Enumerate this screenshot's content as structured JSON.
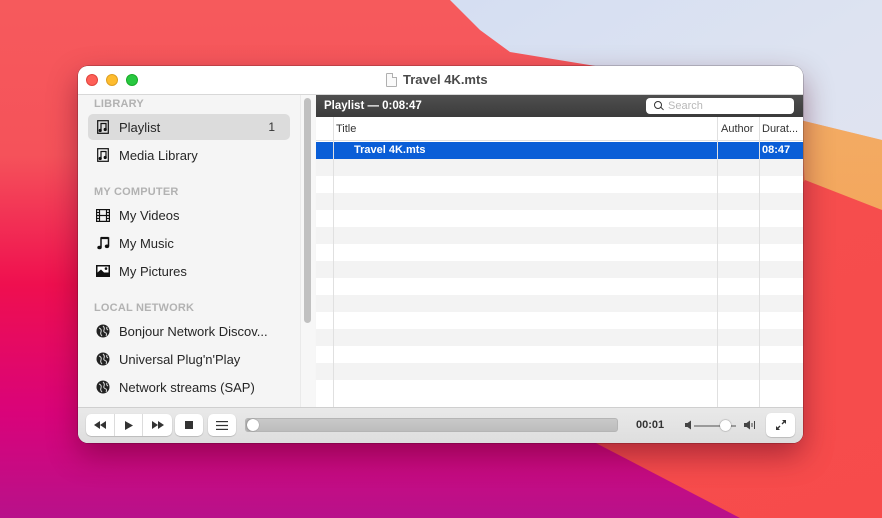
{
  "window": {
    "title": "Travel 4K.mts",
    "traffic_lights": {
      "close_color": "#fe5f57",
      "minimize_color": "#febc2e",
      "maximize_color": "#28c840"
    }
  },
  "sidebar": {
    "sections": [
      {
        "title": "LIBRARY",
        "items": [
          {
            "label": "Playlist",
            "icon": "playlist-icon",
            "badge": "1",
            "selected": true
          },
          {
            "label": "Media Library",
            "icon": "playlist-icon",
            "badge": "",
            "selected": false
          }
        ]
      },
      {
        "title": "MY COMPUTER",
        "items": [
          {
            "label": "My Videos",
            "icon": "film-icon"
          },
          {
            "label": "My Music",
            "icon": "music-note-icon"
          },
          {
            "label": "My Pictures",
            "icon": "picture-icon"
          }
        ]
      },
      {
        "title": "LOCAL NETWORK",
        "items": [
          {
            "label": "Bonjour Network Discov...",
            "icon": "network-globe-icon"
          },
          {
            "label": "Universal Plug'n'Play",
            "icon": "network-globe-icon"
          },
          {
            "label": "Network streams (SAP)",
            "icon": "network-globe-icon"
          }
        ]
      }
    ]
  },
  "playlist": {
    "header_title": "Playlist — 0:08:47",
    "search_placeholder": "Search",
    "search_value": "",
    "columns": [
      "Title",
      "Author",
      "Durat..."
    ],
    "rows": [
      {
        "title": "Travel 4K.mts",
        "author": "",
        "duration": "08:47",
        "selected": true
      }
    ],
    "selection_color": "#0a5ed7"
  },
  "controls": {
    "rewind_icon": "rewind-icon",
    "play_icon": "play-icon",
    "forward_icon": "fast-forward-icon",
    "stop_icon": "stop-icon",
    "playlist_toggle_icon": "list-icon",
    "elapsed_time": "00:01",
    "progress_fraction": 0.002,
    "volume_fraction": 0.75,
    "fullscreen_icon": "fullscreen-icon"
  }
}
